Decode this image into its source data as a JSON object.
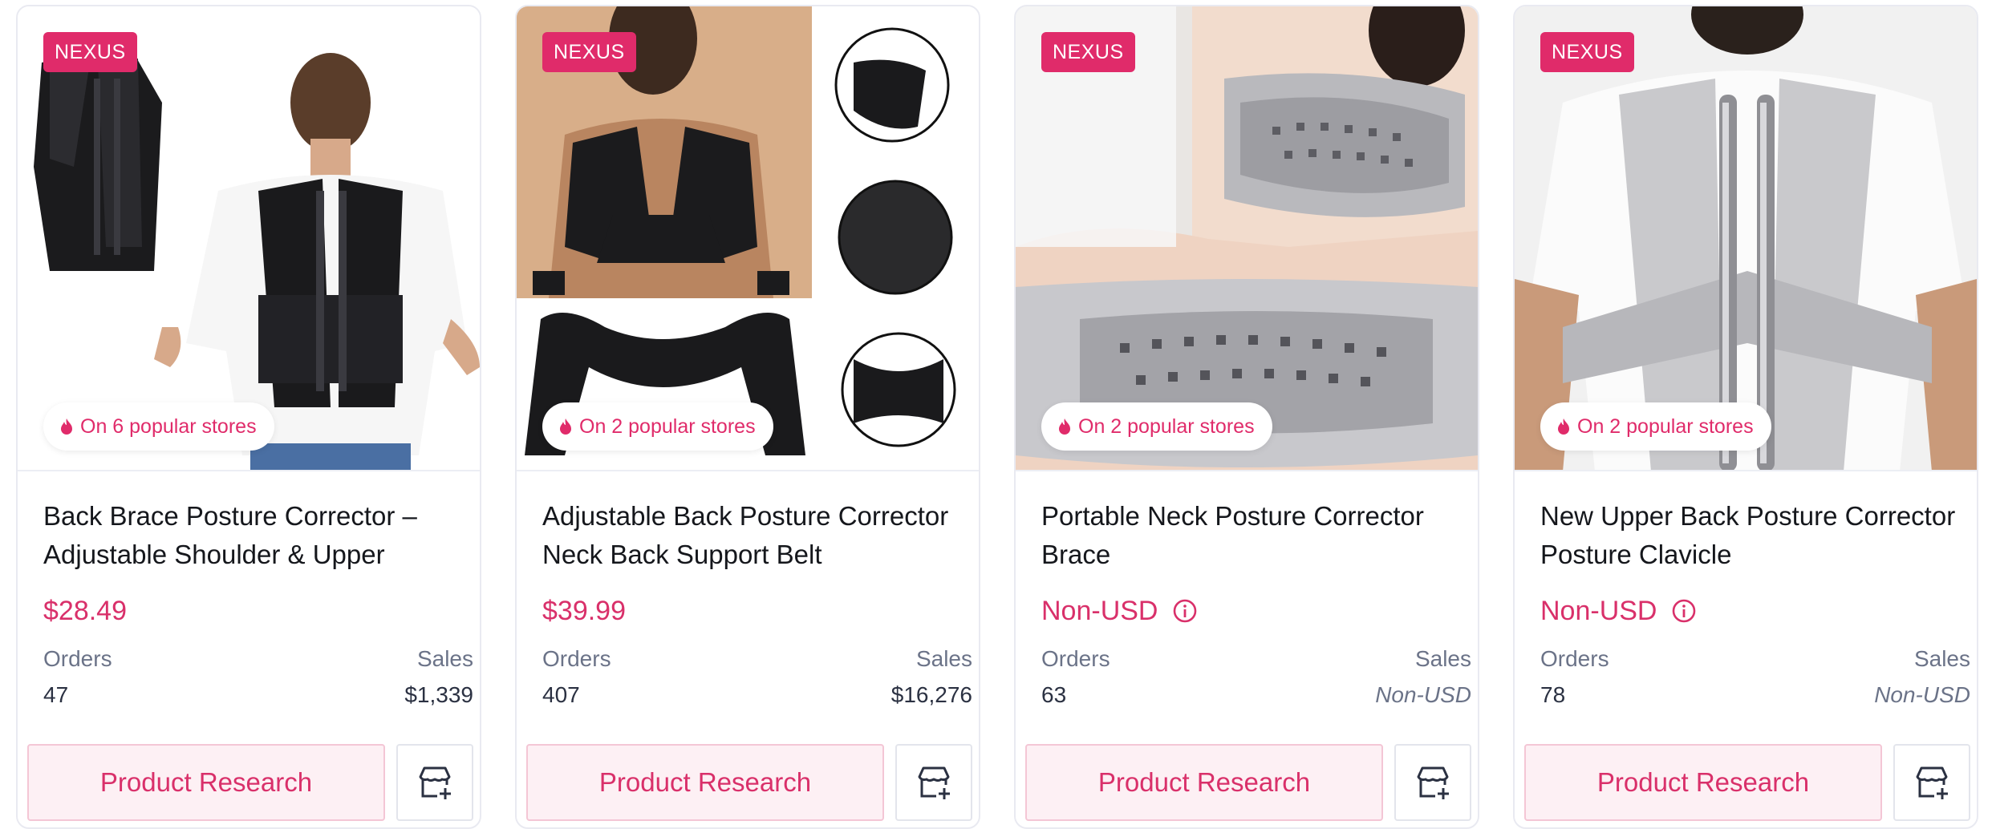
{
  "colors": {
    "accent": "#e02b6a",
    "muted": "#6b7388",
    "button_bg": "#fdf0f4"
  },
  "icons": {
    "stores": "fire-icon",
    "price_info": "info-icon",
    "store_action": "add-store-icon"
  },
  "cards": [
    {
      "badge": "NEXUS",
      "stores": "On 6 popular stores",
      "title": "Back Brace Posture Corrector – Adjustable Shoulder & Upper",
      "price": "$28.49",
      "orders_label": "Orders",
      "sales_label": "Sales",
      "orders": "47",
      "sales": "$1,339",
      "button": "Product Research"
    },
    {
      "badge": "NEXUS",
      "stores": "On 2 popular stores",
      "title": "Adjustable Back Posture Corrector Neck Back Support Belt",
      "price": "$39.99",
      "orders_label": "Orders",
      "sales_label": "Sales",
      "orders": "407",
      "sales": "$16,276",
      "button": "Product Research"
    },
    {
      "badge": "NEXUS",
      "stores": "On 2 popular stores",
      "title": "Portable Neck Posture Corrector Brace",
      "price": "Non-USD",
      "orders_label": "Orders",
      "sales_label": "Sales",
      "orders": "63",
      "sales": "Non-USD",
      "button": "Product Research"
    },
    {
      "badge": "NEXUS",
      "stores": "On 2 popular stores",
      "title": "New Upper Back Posture Corrector Posture Clavicle",
      "price": "Non-USD",
      "orders_label": "Orders",
      "sales_label": "Sales",
      "orders": "78",
      "sales": "Non-USD",
      "button": "Product Research"
    }
  ]
}
